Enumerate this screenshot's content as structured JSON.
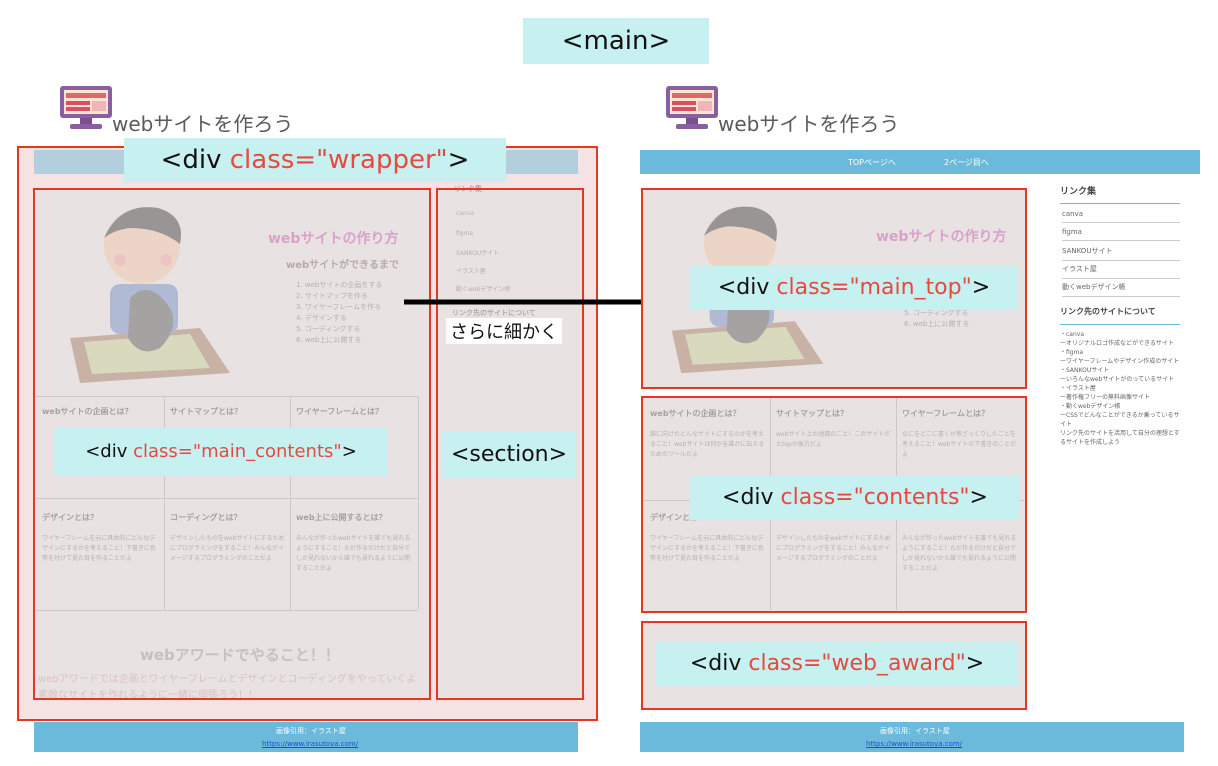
{
  "header_label": {
    "open": "<",
    "tag": "main",
    "close": ">"
  },
  "site_title": "webサイトを作ろう",
  "left": {
    "wrapper_label": {
      "prefix": "<div ",
      "cls": "class=\"wrapper\"",
      "suffix": ">"
    },
    "main_contents_label": {
      "prefix": "<div ",
      "cls": "class=\"main_contents\"",
      "suffix": ">"
    },
    "section_label": "<section>"
  },
  "arrow_caption": "さらに細かく",
  "right": {
    "nav": [
      "TOPページへ",
      "2ページ目へ"
    ],
    "main_top_label": {
      "prefix": "<div ",
      "cls": "class=\"main_top\"",
      "suffix": ">"
    },
    "contents_label": {
      "prefix": "<div ",
      "cls": "class=\"contents\"",
      "suffix": ">"
    },
    "web_award_label": {
      "prefix": "<div ",
      "cls": "class=\"web_award\"",
      "suffix": ">"
    }
  },
  "page": {
    "hero_title": "webサイトの作り方",
    "hero_subtitle": "webサイトができるまで",
    "steps": [
      "1. webサイトの企画をする",
      "2. サイトマップを作る",
      "3. ワイヤーフレームを作る",
      "4. デザインする",
      "5. コーディングする",
      "6. web上に公開する"
    ],
    "cards": [
      {
        "title": "webサイトの企画とは？",
        "body": "誰に向けたどんなサイトにするのかを考えること！webサイトは何かを誰かに伝えるためのツールだよ"
      },
      {
        "title": "サイトマップとは？",
        "body": "webサイト上の地図のこと！このサイトだとtopの後方だよ"
      },
      {
        "title": "ワイヤーフレームとは？",
        "body": "なにをどこに書くか等ざっくりしたことを考えること！webサイトの下書きのことだよ"
      },
      {
        "title": "デザインとは？",
        "body": "ワイヤーフレームを元に具体的にどんなデザインにするかを考えること！下書きに色等を付けて見た目を作ることだよ"
      },
      {
        "title": "コーディングとは？",
        "body": "デザインしたものをwebサイトにするためにプログラミングをすること！みんながイメージするプログラミングのことだよ"
      },
      {
        "title": "web上に公開するとは？",
        "body": "みんなが作ったwebサイトを誰でも見れるようにすること！ただ作るだけだと自分でしか見れないから誰でも見れるように公開することだよ"
      }
    ],
    "award_title": "webアワードでやること！！",
    "award_text": "webアワードでは企画とワイヤーフレームとデザインとコーディングをやっていくよ素敵なサイトを作れるように一緒に頑張ろう！！",
    "sidebar_title": "リンク集",
    "sidebar_links": [
      "canva",
      "figma",
      "SANKOUサイト",
      "イラスト屋",
      "動くwebデザイン帳"
    ],
    "sidebar_about_title": "リンク先のサイトについて",
    "sidebar_about": [
      "・canva",
      "ーオリジナルロゴ作成などができるサイト",
      "・figma",
      "ーワイヤーフレームやデザイン作成のサイト",
      "・SANKOUサイト",
      "ーいろんなwebサイトがのっているサイト",
      "・イラスト屋",
      "ー著作権フリーの無料画像サイト",
      "・動くwebデザイン帳",
      "ーCSSでどんなことができるか乗っているサイト",
      "リンク先のサイトを活用して自分の理想とするサイトを作成しよう"
    ],
    "footer_credit": "画像引用：イラスト屋",
    "footer_url": "https://www.irasutoya.com/"
  },
  "colors": {
    "accent_red": "#e53822",
    "label_bg": "#c7f0f0",
    "nav_blue": "#6bbadb"
  }
}
